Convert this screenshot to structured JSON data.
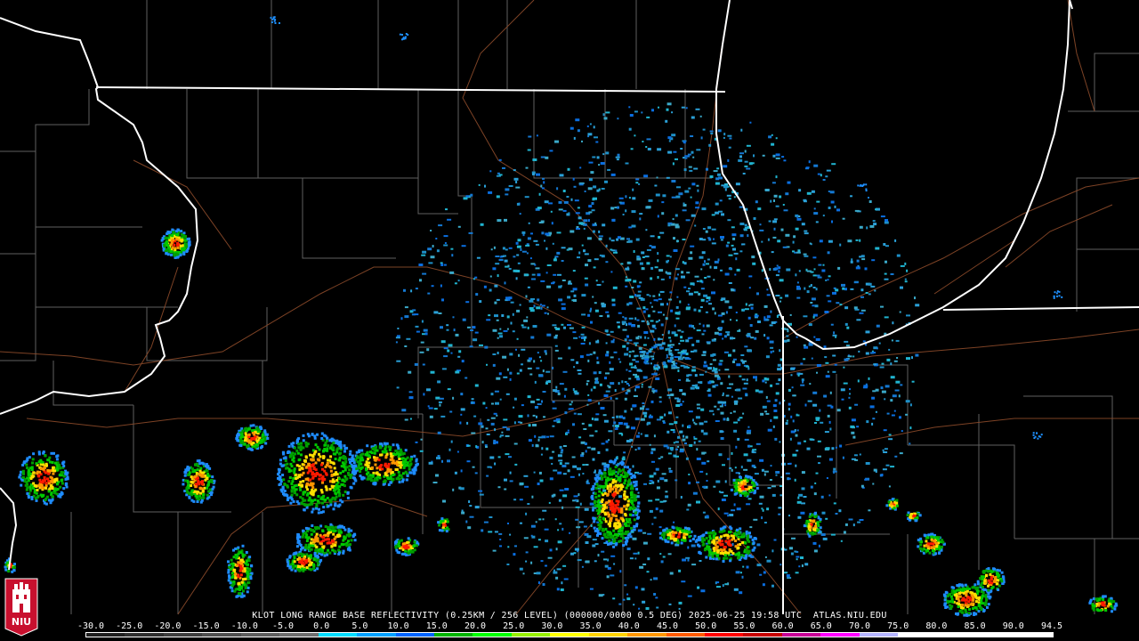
{
  "product": {
    "caption": "KLOT LONG RANGE BASE REFLECTIVITY (0.25KM / 256 LEVEL) (000000/0000 0.5 DEG) 2025-06-25 19:58 UTC  ATLAS.NIU.EDU",
    "radar_site": "KLOT",
    "elevation_deg": 0.5,
    "valid_time": "2025-06-25 19:58 UTC",
    "source": "ATLAS.NIU.EDU"
  },
  "logo": {
    "text": "NIU",
    "icon": "niu-seal-icon"
  },
  "colorbar": {
    "tick_labels": [
      "-30.0",
      "-25.0",
      "-20.0",
      "-15.0",
      "-10.0",
      "-5.0",
      "0.0",
      "5.0",
      "10.0",
      "15.0",
      "20.0",
      "25.0",
      "30.0",
      "35.0",
      "40.0",
      "45.0",
      "50.0",
      "55.0",
      "60.0",
      "65.0",
      "70.0",
      "75.0",
      "80.0",
      "85.0",
      "90.0",
      "94.5"
    ],
    "colors": [
      "#1e1e1e",
      "#2e2e2e",
      "#3e3e3e",
      "#4e4e4e",
      "#5e5e5e",
      "#6e6e6e",
      "#00dcff",
      "#00a0ff",
      "#0064ff",
      "#00b400",
      "#00ff00",
      "#96f000",
      "#ffff00",
      "#ffd200",
      "#ff9600",
      "#ff5a00",
      "#ff0000",
      "#c80000",
      "#c80096",
      "#ff00ff",
      "#b4b4ff",
      "#ffffff",
      "#ffffff",
      "#ffffff",
      "#ffffff"
    ]
  },
  "chart_data": {
    "type": "radar",
    "variable": "base reflectivity (dBZ)",
    "color_scale_range": [
      -30.0,
      94.5
    ]
  }
}
